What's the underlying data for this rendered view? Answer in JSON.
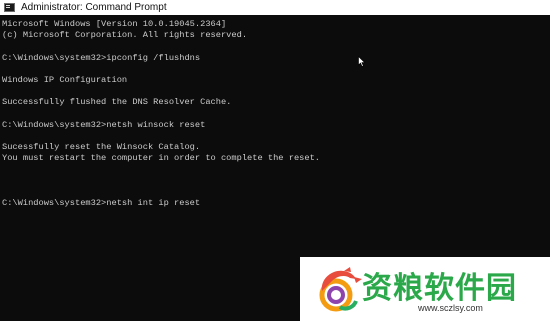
{
  "window": {
    "title": "Administrator: Command Prompt"
  },
  "console": {
    "lines": [
      "Microsoft Windows [Version 10.0.19045.2364]",
      "(c) Microsoft Corporation. All rights reserved.",
      "",
      "C:\\Windows\\system32>ipconfig /flushdns",
      "",
      "Windows IP Configuration",
      "",
      "Successfully flushed the DNS Resolver Cache.",
      "",
      "C:\\Windows\\system32>netsh winsock reset",
      "",
      "Sucessfully reset the Winsock Catalog.",
      "You must restart the computer in order to complete the reset.",
      "",
      "",
      "",
      "C:\\Windows\\system32>netsh int ip reset"
    ]
  },
  "watermark": {
    "name": "资粮软件园",
    "url": "www.sczlsy.com"
  },
  "colors": {
    "console_bg": "#0c0c0c",
    "console_text": "#cccccc",
    "watermark_green": "#2ba84a"
  }
}
